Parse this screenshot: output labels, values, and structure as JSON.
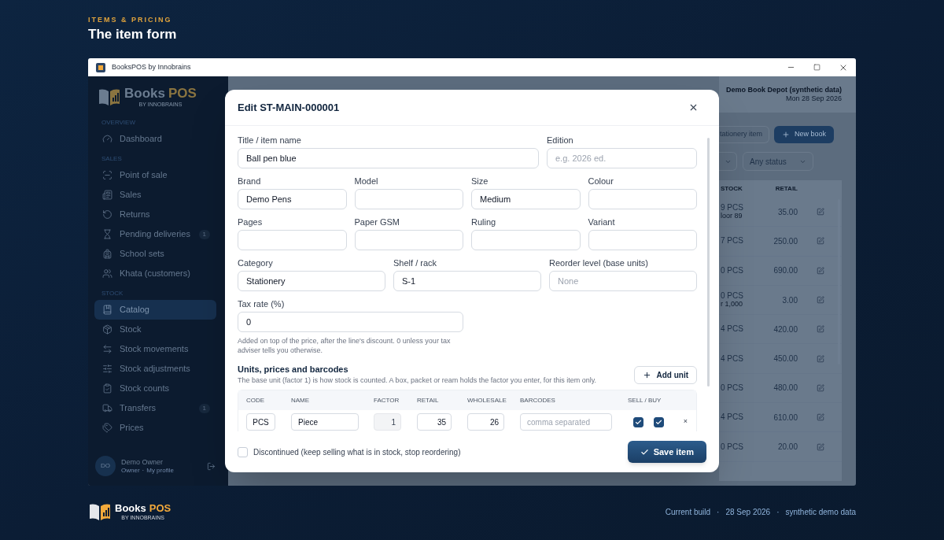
{
  "page_header": {
    "eyebrow": "ITEMS & PRICING",
    "title": "The item form"
  },
  "window": {
    "title": "BooksPOS by Innobrains"
  },
  "sidebar": {
    "logo": {
      "name": "Books",
      "accent": "POS",
      "tagline": "BY INNOBRAINS"
    },
    "sections": [
      {
        "heading": "OVERVIEW",
        "items": [
          {
            "label": "Dashboard",
            "selected": false
          }
        ]
      },
      {
        "heading": "SALES",
        "items": [
          {
            "label": "Point of sale",
            "selected": false
          },
          {
            "label": "Sales",
            "selected": false
          },
          {
            "label": "Returns",
            "selected": false
          },
          {
            "label": "Pending deliveries",
            "selected": false,
            "badge": "1"
          },
          {
            "label": "School sets",
            "selected": false
          },
          {
            "label": "Khata (customers)",
            "selected": false
          }
        ]
      },
      {
        "heading": "STOCK",
        "items": [
          {
            "label": "Catalog",
            "selected": true
          },
          {
            "label": "Stock",
            "selected": false
          },
          {
            "label": "Stock movements",
            "selected": false
          },
          {
            "label": "Stock adjustments",
            "selected": false
          },
          {
            "label": "Stock counts",
            "selected": false
          },
          {
            "label": "Transfers",
            "selected": false,
            "badge": "1"
          },
          {
            "label": "Prices",
            "selected": false
          }
        ]
      }
    ],
    "user": {
      "initials": "DO",
      "name": "Demo Owner",
      "role": "Owner",
      "separator": "·",
      "link": "My profile"
    }
  },
  "main": {
    "store": "Demo Book Depot (synthetic data)",
    "date": "Mon 28 Sep 2026",
    "buttons": [
      {
        "label": "tationery item",
        "kind": "secondary"
      },
      {
        "label": "New book",
        "kind": "primary"
      }
    ],
    "filter": "Any status",
    "table": {
      "columns": [
        "STOCK",
        "RETAIL"
      ],
      "rows": [
        {
          "stock": "9 PCS",
          "note": "loor 89",
          "retail": "35.00"
        },
        {
          "stock": "7 PCS",
          "retail": "250.00"
        },
        {
          "stock": "0 PCS",
          "retail": "690.00"
        },
        {
          "stock": "0 PCS",
          "note": "r 1,000",
          "retail": "3.00"
        },
        {
          "stock": "4 PCS",
          "retail": "420.00"
        },
        {
          "stock": "4 PCS",
          "retail": "450.00"
        },
        {
          "stock": "0 PCS",
          "retail": "480.00"
        },
        {
          "stock": "4 PCS",
          "retail": "610.00"
        },
        {
          "stock": "0 PCS",
          "retail": "20.00"
        }
      ]
    }
  },
  "dialog": {
    "title": "Edit ST-MAIN-000001",
    "field_rows": [
      [
        {
          "label": "Title / item name",
          "value": "Ball pen blue"
        },
        {
          "label": "Edition",
          "placeholder": "e.g. 2026 ed."
        }
      ],
      [
        {
          "label": "Brand",
          "value": "Demo Pens"
        },
        {
          "label": "Model"
        },
        {
          "label": "Size",
          "value": "Medium"
        },
        {
          "label": "Colour"
        }
      ],
      [
        {
          "label": "Pages"
        },
        {
          "label": "Paper GSM"
        },
        {
          "label": "Ruling"
        },
        {
          "label": "Variant"
        }
      ],
      [
        {
          "label": "Category",
          "value": "Stationery"
        },
        {
          "label": "Shelf / rack",
          "value": "S-1"
        },
        {
          "label": "Reorder level (base units)",
          "placeholder": "None"
        }
      ]
    ],
    "tax": {
      "label": "Tax rate (%)",
      "value": "0",
      "help": "Added on top of the price, after the line's discount. 0 unless your tax adviser tells you otherwise."
    },
    "units": {
      "heading": "Units, prices and barcodes",
      "description": "The base unit (factor 1) is how stock is counted. A box, packet or ream holds the factor you enter, for this item only.",
      "add_button": "Add unit",
      "columns": [
        "CODE",
        "NAME",
        "FACTOR",
        "RETAIL",
        "WHOLESALE",
        "BARCODES",
        "SELL / BUY"
      ],
      "rows": [
        {
          "code": "PCS",
          "name": "Piece",
          "factor": "1",
          "factor_disabled": true,
          "retail": "35",
          "wholesale": "26",
          "barcodes_placeholder": "comma separated",
          "sell": true,
          "buy": true,
          "remove": "×"
        }
      ]
    },
    "discontinued": {
      "label": "Discontinued (keep selling what is in stock, stop reordering)",
      "checked": false
    },
    "save_button": "Save item"
  },
  "footer": {
    "logo": {
      "name": "Books",
      "accent": "POS",
      "tagline": "BY INNOBRAINS"
    },
    "separator": "·",
    "meta": [
      "Current build",
      "28 Sep 2026",
      "synthetic demo data"
    ]
  }
}
